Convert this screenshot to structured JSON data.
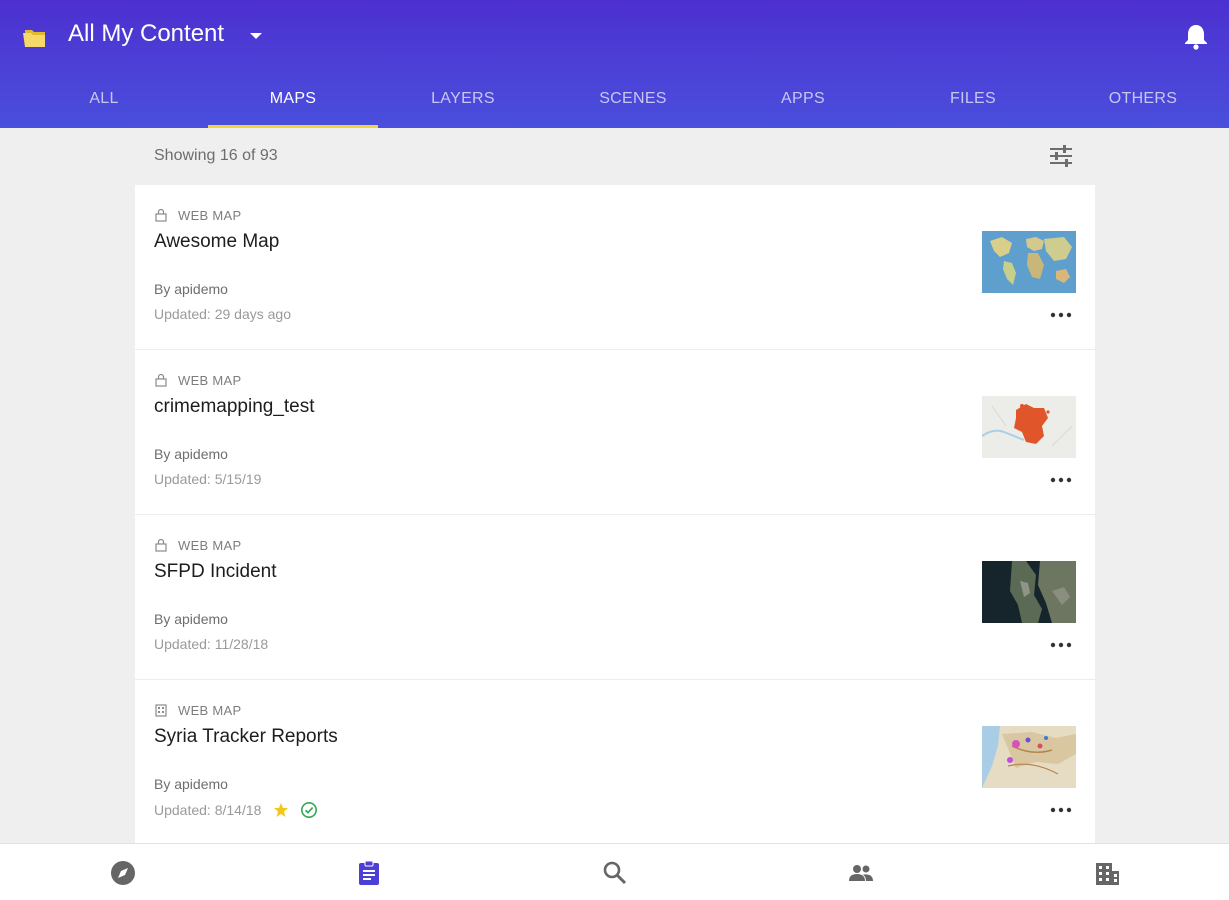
{
  "header": {
    "title": "All My Content",
    "accent": "#4d30d0",
    "tab_indicator": "#f2d43a"
  },
  "tabs": [
    {
      "label": "ALL"
    },
    {
      "label": "MAPS",
      "active": true
    },
    {
      "label": "LAYERS"
    },
    {
      "label": "SCENES"
    },
    {
      "label": "APPS"
    },
    {
      "label": "FILES"
    },
    {
      "label": "OTHERS"
    }
  ],
  "list": {
    "showing": "Showing 16 of 93",
    "items": [
      {
        "type": "WEB MAP",
        "title": "Awesome Map",
        "owner": "By apidemo",
        "updated": "Updated: 29 days ago",
        "type_icon": "lock-icon",
        "thumb": "world-map-thumbnail"
      },
      {
        "type": "WEB MAP",
        "title": "crimemapping_test",
        "owner": "By apidemo",
        "updated": "Updated: 5/15/19",
        "type_icon": "lock-icon",
        "thumb": "crime-map-thumbnail"
      },
      {
        "type": "WEB MAP",
        "title": "SFPD Incident",
        "owner": "By apidemo",
        "updated": "Updated: 11/28/18",
        "type_icon": "lock-icon",
        "thumb": "satellite-map-thumbnail"
      },
      {
        "type": "WEB MAP",
        "title": "Syria Tracker Reports",
        "owner": "By apidemo",
        "updated": "Updated: 8/14/18",
        "type_icon": "organization-icon",
        "thumb": "syria-map-thumbnail",
        "favorite": true,
        "authoritative": true
      }
    ]
  },
  "bottom_nav": [
    "explore-icon",
    "content-icon",
    "search-icon",
    "groups-icon",
    "organization-icon"
  ],
  "colors": {
    "star": "#f5c518",
    "check": "#35a853",
    "nav_active": "#4b3fd6",
    "nav_inactive": "#666666"
  }
}
